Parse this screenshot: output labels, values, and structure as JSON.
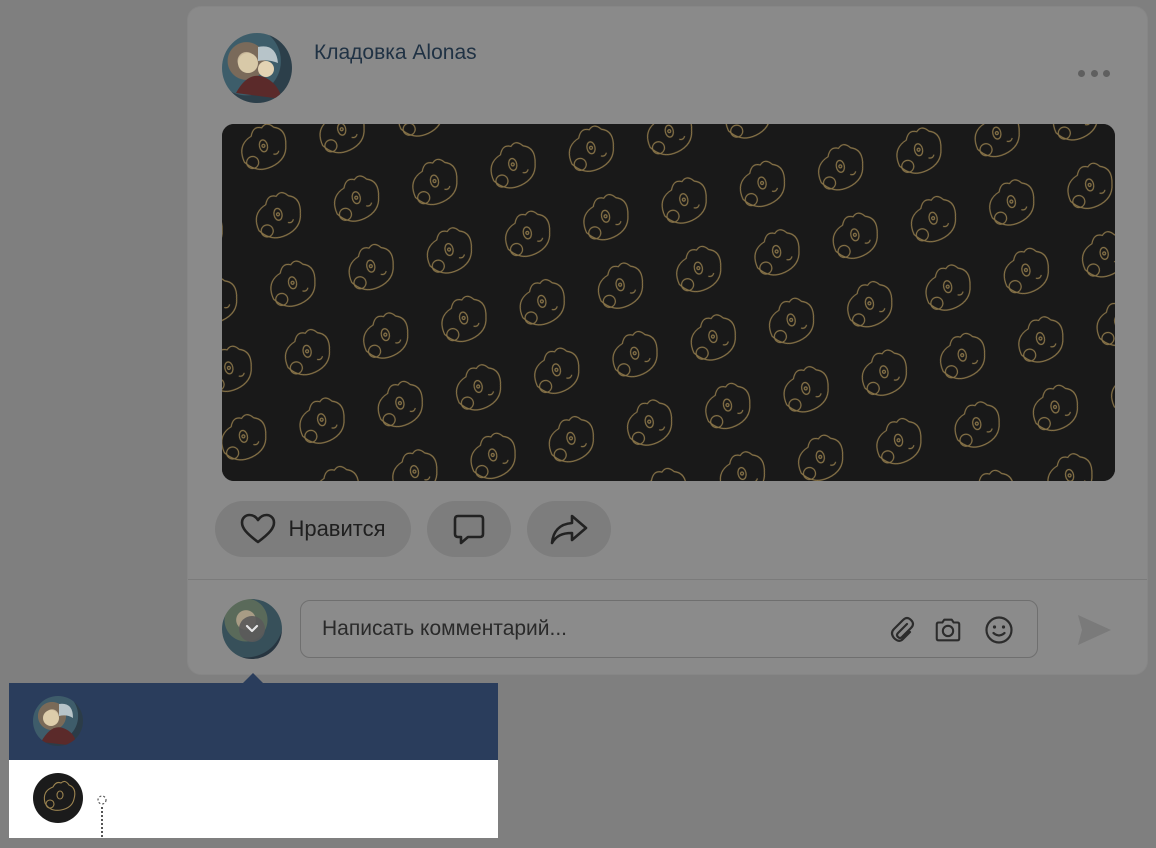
{
  "post": {
    "author_name": "Кладовка Alonas",
    "more_icon": "more-horizontal-icon",
    "image_pattern": "bear-head-outline-pattern",
    "colors": {
      "image_bg": "#191919",
      "pattern_stroke": "#9c8450",
      "accent": "#2a3d5c"
    }
  },
  "actions": {
    "like_label": "Нравится",
    "like_icon": "heart-icon",
    "comment_icon": "comment-icon",
    "share_icon": "share-arrow-icon"
  },
  "composer": {
    "placeholder": "Написать комментарий...",
    "attach_icon": "paperclip-icon",
    "camera_icon": "camera-icon",
    "emoji_icon": "smile-icon",
    "send_icon": "send-icon",
    "avatar_chevron_icon": "chevron-down-icon"
  },
  "author_switcher": {
    "items": [
      {
        "avatar": "personal-avatar",
        "selected": true
      },
      {
        "avatar": "community-avatar",
        "selected": false
      }
    ]
  }
}
